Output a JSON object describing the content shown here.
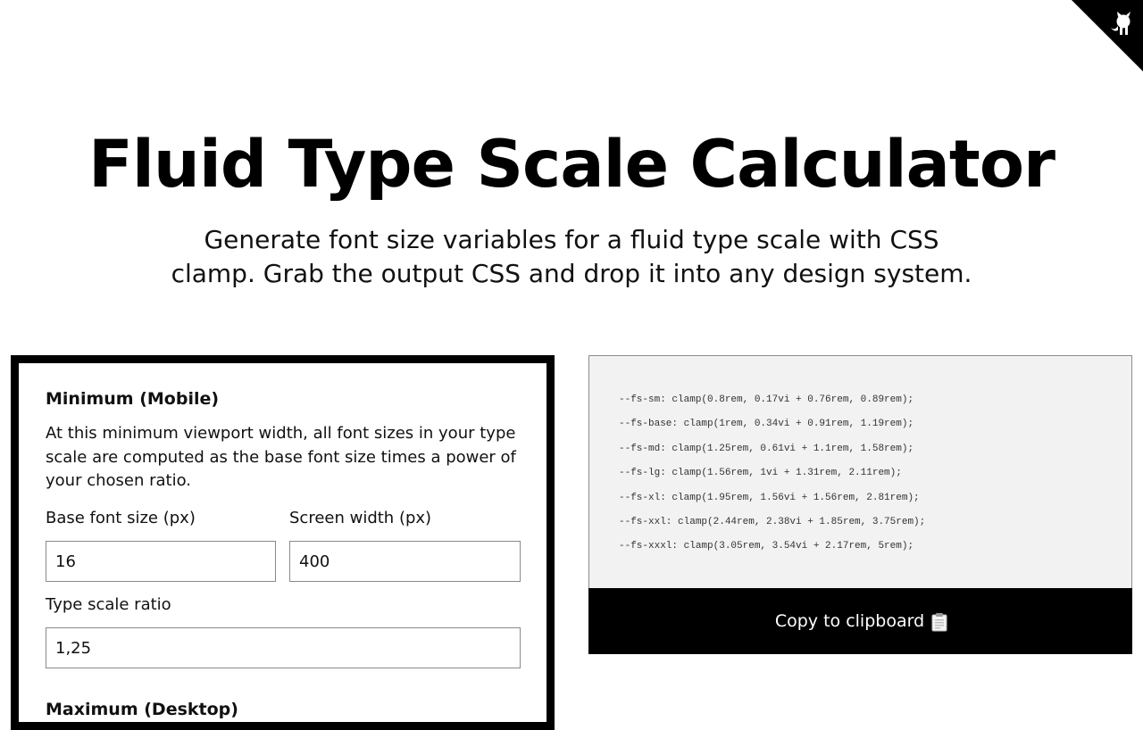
{
  "header": {
    "title": "Fluid Type Scale Calculator",
    "subtitle": "Generate font size variables for a fluid type scale with CSS clamp. Grab the output CSS and drop it into any design system."
  },
  "corner_link": {
    "icon": "github-octocat-icon"
  },
  "form": {
    "minimum": {
      "heading": "Minimum (Mobile)",
      "description": "At this minimum viewport width, all font sizes in your type scale are computed as the base font size times a power of your chosen ratio.",
      "base_font_size_label": "Base font size (px)",
      "base_font_size_value": "16",
      "screen_width_label": "Screen width (px)",
      "screen_width_value": "400",
      "ratio_label": "Type scale ratio",
      "ratio_value": "1,25"
    },
    "maximum": {
      "heading": "Maximum (Desktop)"
    }
  },
  "output": {
    "lines": [
      "--fs-sm: clamp(0.8rem, 0.17vi + 0.76rem, 0.89rem);",
      "--fs-base: clamp(1rem, 0.34vi + 0.91rem, 1.19rem);",
      "--fs-md: clamp(1.25rem, 0.61vi + 1.1rem, 1.58rem);",
      "--fs-lg: clamp(1.56rem, 1vi + 1.31rem, 2.11rem);",
      "--fs-xl: clamp(1.95rem, 1.56vi + 1.56rem, 2.81rem);",
      "--fs-xxl: clamp(2.44rem, 2.38vi + 1.85rem, 3.75rem);",
      "--fs-xxxl: clamp(3.05rem, 3.54vi + 2.17rem, 5rem);"
    ],
    "copy_label": "Copy to clipboard",
    "copy_icon": "clipboard-icon"
  },
  "colors": {
    "primary": "#000000",
    "output_background": "#f2f2f2",
    "input_border": "#8a8a8a"
  }
}
